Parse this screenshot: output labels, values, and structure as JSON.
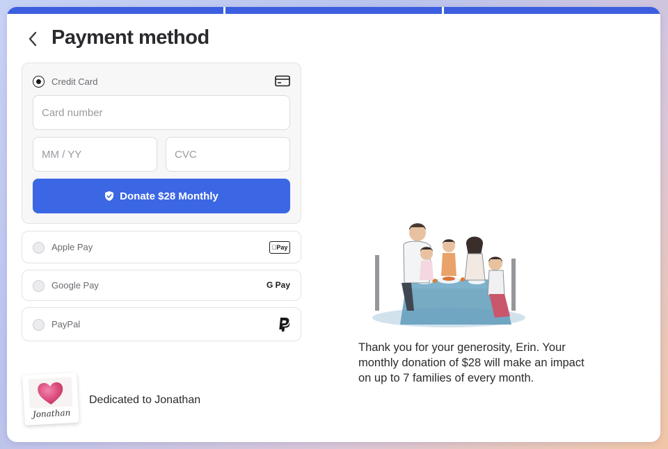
{
  "header": {
    "title": "Payment method"
  },
  "progress": {
    "steps_total": 3,
    "steps_completed": 3
  },
  "payment": {
    "selected": "Credit Card",
    "credit_card": {
      "label": "Credit Card",
      "card_number_placeholder": "Card number",
      "expiry_placeholder": "MM / YY",
      "cvc_placeholder": "CVC",
      "donate_label": "Donate $28 Monthly"
    },
    "options": [
      {
        "label": "Apple Pay",
        "logo_text": "Pay",
        "icon": "apple-pay-icon"
      },
      {
        "label": "Google Pay",
        "logo_text": "G Pay",
        "icon": "google-pay-icon"
      },
      {
        "label": "PayPal",
        "icon": "paypal-icon"
      }
    ]
  },
  "dedication": {
    "signature": "Jonathan",
    "text": "Dedicated to Jonathan"
  },
  "thanks": {
    "message": "Thank you for your generosity, Erin. Your monthly donation of $28 will make an impact on up to 7 families of every month."
  },
  "colors": {
    "accent": "#3b66e4",
    "progress": "#3b5fe0",
    "text": "#2a2a2e"
  }
}
